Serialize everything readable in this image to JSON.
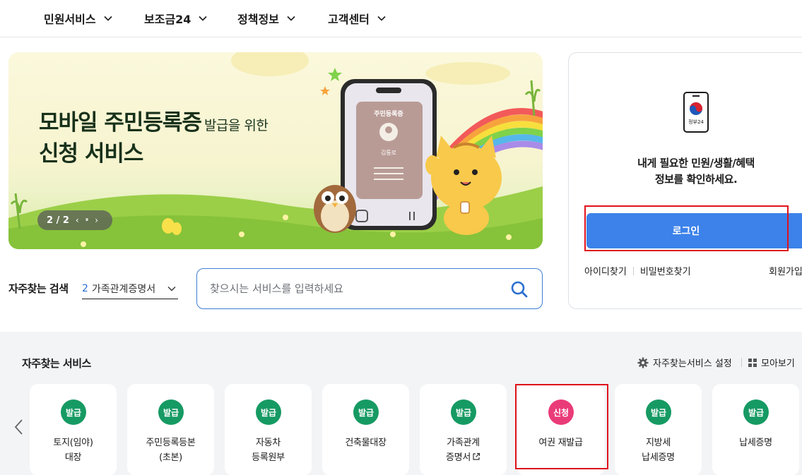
{
  "nav": {
    "items": [
      {
        "label": "민원서비스",
        "icon": "chevron-down-icon"
      },
      {
        "label": "보조금24",
        "icon": "chevron-down-icon"
      },
      {
        "label": "정책정보",
        "icon": "chevron-down-icon"
      },
      {
        "label": "고객센터",
        "icon": "chevron-down-icon"
      }
    ]
  },
  "banner": {
    "title_main": "모바일 주민등록증",
    "title_small": "발급을 위한",
    "title_line2": "신청 서비스",
    "phone_card_title": "주민등록증",
    "phone_card_name": "김통로",
    "pager_text": "2 / 2",
    "pager_prev": "‹",
    "pager_pause": "⏸",
    "pager_next": "›"
  },
  "search": {
    "label": "자주찾는 검색",
    "select_number": "2",
    "select_value": "가족관계증명서",
    "placeholder": "찾으시는 서비스를 입력하세요",
    "button_icon": "search-icon"
  },
  "login": {
    "app_icon_label": "정부24",
    "message_line1": "내게 필요한 민원/생활/혜택",
    "message_line2": "정보를 확인하세요.",
    "button_label": "로그인",
    "find_id": "아이디찾기",
    "find_password": "비밀번호찾기",
    "signup": "회원가입"
  },
  "services": {
    "title": "자주찾는 서비스",
    "settings_label": "자주찾는서비스 설정",
    "view_all_label": "모아보기",
    "colors": {
      "issue": "#169a63",
      "apply": "#ea3b79",
      "highlight": "#e0121b"
    },
    "cards": [
      {
        "badge": "발급",
        "line1": "토지(임야)",
        "line2": "대장"
      },
      {
        "badge": "발급",
        "line1": "주민등록등본",
        "line2": "(초본)"
      },
      {
        "badge": "발급",
        "line1": "자동차",
        "line2": "등록원부"
      },
      {
        "badge": "발급",
        "line1": "건축물대장",
        "line2": ""
      },
      {
        "badge": "발급",
        "line1": "가족관계",
        "line2": "증명서"
      },
      {
        "badge": "신청",
        "line1": "여권 재발급",
        "line2": ""
      },
      {
        "badge": "발급",
        "line1": "지방세",
        "line2": "납세증명"
      },
      {
        "badge": "발급",
        "line1": "납세증명",
        "line2": ""
      }
    ]
  }
}
